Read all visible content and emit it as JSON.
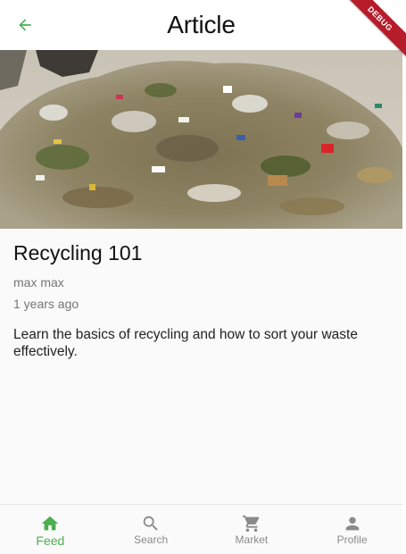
{
  "app_bar": {
    "title": "Article",
    "back_icon": "arrow-back-icon",
    "accent_color": "#4caf50"
  },
  "debug_banner": {
    "label": "DEBUG",
    "color": "#b71c2b"
  },
  "article": {
    "image_alt": "pile of mixed waste and trash",
    "title": "Recycling 101",
    "author": "max max",
    "date": "1 years ago",
    "body": "Learn the basics of recycling and how to sort your waste effectively."
  },
  "bottom_nav": {
    "items": [
      {
        "label": "Feed",
        "icon": "home-icon",
        "active": true
      },
      {
        "label": "Search",
        "icon": "search-icon",
        "active": false
      },
      {
        "label": "Market",
        "icon": "cart-icon",
        "active": false
      },
      {
        "label": "Profile",
        "icon": "person-icon",
        "active": false
      }
    ],
    "active_color": "#4caf50",
    "inactive_color": "#8a8a8a"
  }
}
